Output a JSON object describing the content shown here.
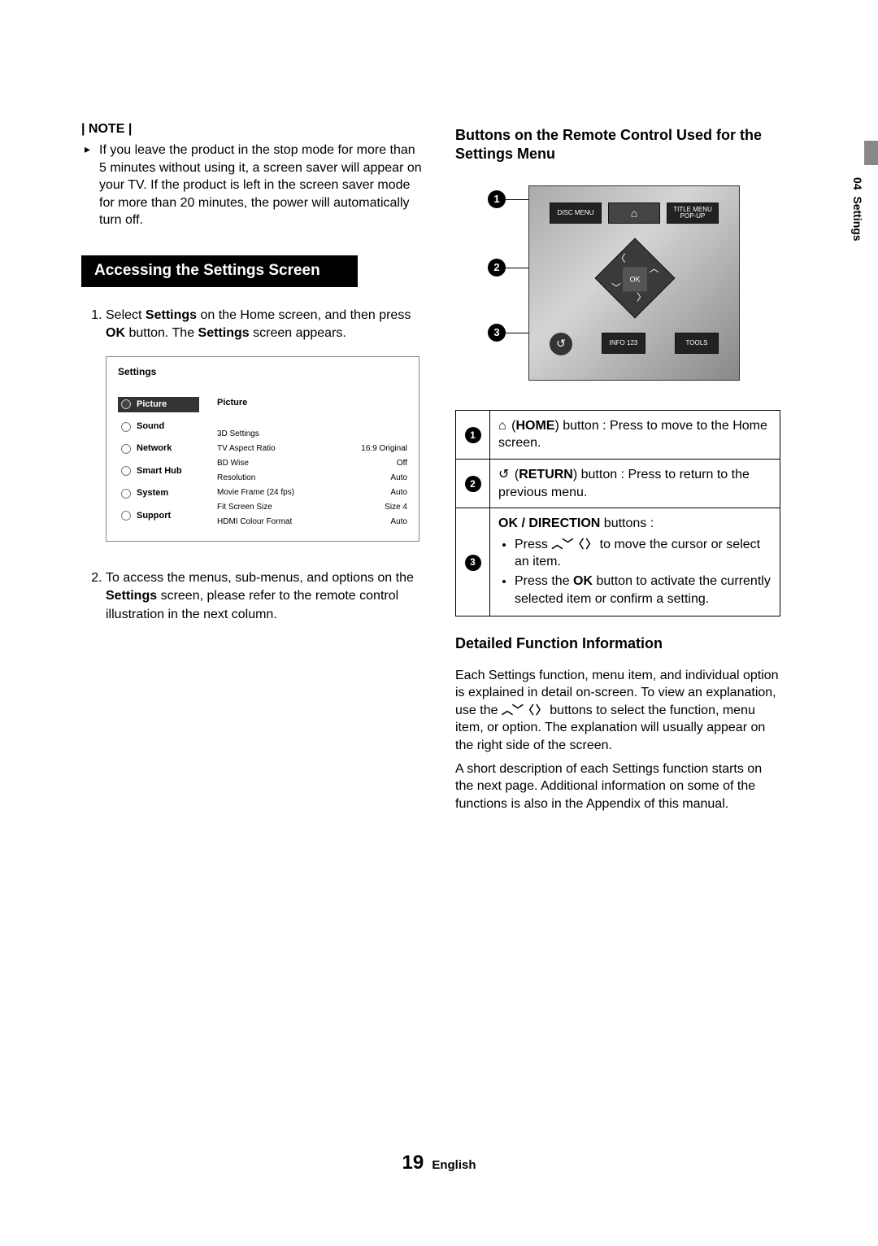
{
  "note": {
    "label": "| NOTE |",
    "body": "If you leave the product in the stop mode for more than 5 minutes without using it, a screen saver will appear on your TV. If the product is left in the screen saver mode for more than 20 minutes, the power will automatically turn off."
  },
  "section_access_title": "Accessing the Settings Screen",
  "step1_pre": "Select ",
  "step1_b1": "Settings",
  "step1_mid": " on the Home screen, and then press ",
  "step1_b2": "OK",
  "step1_mid2": " button. The ",
  "step1_b3": "Settings",
  "step1_end": " screen appears.",
  "step2_pre": "To access the menus, sub-menus, and options on the ",
  "step2_b1": "Settings",
  "step2_end": " screen, please refer to the remote control illustration in the next column.",
  "settings_ui": {
    "title": "Settings",
    "nav": [
      "Picture",
      "Sound",
      "Network",
      "Smart Hub",
      "System",
      "Support"
    ],
    "content_title": "Picture",
    "rows": [
      {
        "label": "3D Settings",
        "value": ""
      },
      {
        "label": "TV Aspect Ratio",
        "value": "16:9 Original"
      },
      {
        "label": "BD Wise",
        "value": "Off"
      },
      {
        "label": "Resolution",
        "value": "Auto"
      },
      {
        "label": "Movie Frame (24 fps)",
        "value": "Auto"
      },
      {
        "label": "Fit Screen Size",
        "value": "Size 4"
      },
      {
        "label": "HDMI Colour Format",
        "value": "Auto"
      }
    ]
  },
  "right_heading_buttons": "Buttons on the Remote Control Used for the Settings Menu",
  "remote": {
    "disc_menu": "DISC MENU",
    "title_menu": "TITLE MENU POP-UP",
    "ok": "OK",
    "info": "INFO 123",
    "tools": "TOOLS",
    "callouts": {
      "c1": "1",
      "c2": "2",
      "c3": "3"
    }
  },
  "button_table": {
    "row1_num": "1",
    "row1_label": "HOME",
    "row1_home_icon": "⌂",
    "row1_text_pre": " (",
    "row1_text_mid": ") button : Press to move to the Home screen.",
    "row2_num": "2",
    "row2_icon": "↺",
    "row2_label": "RETURN",
    "row2_text": ") button : Press to return to the previous menu.",
    "row3_num": "3",
    "row3_headlabel": "OK / DIRECTION",
    "row3_headtext": " buttons :",
    "row3_b1_pre": "Press ",
    "row3_b1_arrows": "︿﹀〈 〉",
    "row3_b1_post": " to move the cursor or select an item.",
    "row3_b2_pre": "Press the ",
    "row3_b2_ok": "OK",
    "row3_b2_post": " button to activate the currently selected item or confirm a setting."
  },
  "detail_heading": "Detailed Function Information",
  "detail_para1a": "Each Settings function, menu item, and individual option is explained in detail on-screen. To view an explanation, use the ",
  "detail_para1_arrows": "︿﹀〈 〉",
  "detail_para1b": " buttons to select the function, menu item, or option. The explanation will usually appear on the right side of the screen.",
  "detail_para2": "A short description of each Settings function starts on the next page. Additional information on some of the functions is also in the Appendix of this manual.",
  "sidetab_num": "04",
  "sidetab_label": "Settings",
  "footer_page": "19",
  "footer_lang": "English"
}
